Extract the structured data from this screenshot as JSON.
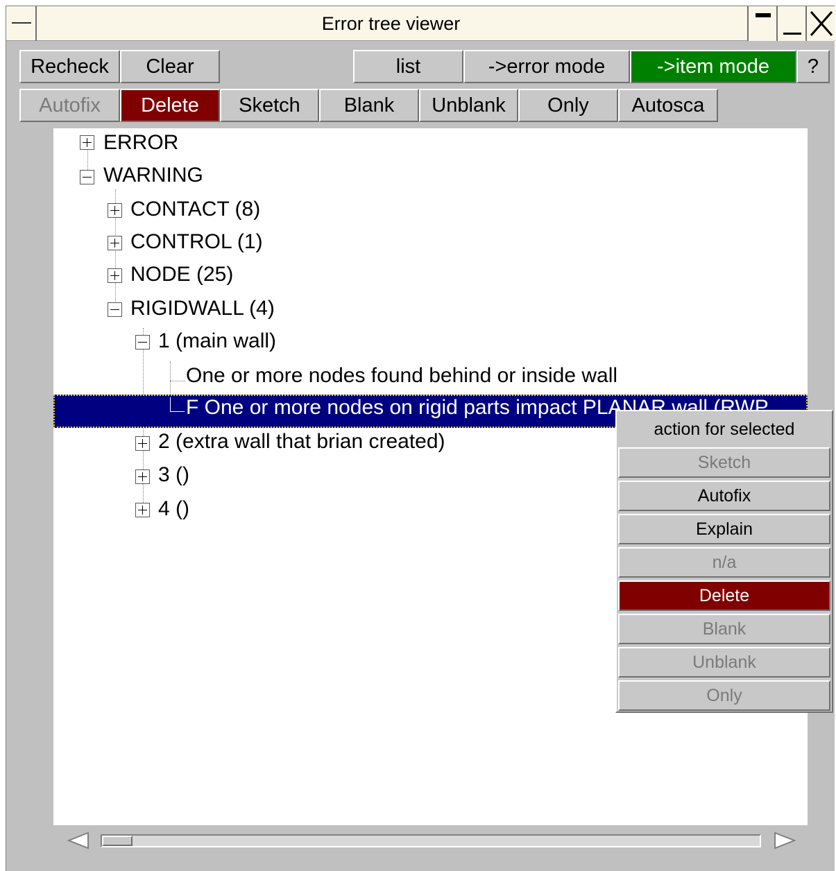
{
  "window": {
    "title": "Error tree viewer"
  },
  "toolbar_row1": {
    "recheck": "Recheck",
    "clear": "Clear",
    "list": "list",
    "error_mode": "->error mode",
    "item_mode": "->item mode",
    "help": "?"
  },
  "toolbar_row2": {
    "autofix": "Autofix",
    "delete": "Delete",
    "sketch": "Sketch",
    "blank": "Blank",
    "unblank": "Unblank",
    "only": "Only",
    "autoscale": "Autosca"
  },
  "tree": {
    "error": "ERROR",
    "warning": "WARNING",
    "contact": "CONTACT (8)",
    "control": "CONTROL (1)",
    "node": "NODE (25)",
    "rigidwall": "RIGIDWALL (4)",
    "wall1": "1 (main wall)",
    "wall1_msg1": "One or more nodes found behind or inside wall",
    "wall1_msg2": "F One or more nodes on rigid parts impact PLANAR wall (RWP",
    "wall2": "2 (extra wall that brian created)",
    "wall3": "3 ()",
    "wall4": "4 ()"
  },
  "context_menu": {
    "title": "action for selected",
    "items": [
      "Sketch",
      "Autofix",
      "Explain",
      "n/a",
      "Delete",
      "Blank",
      "Unblank",
      "Only"
    ]
  },
  "colors": {
    "accent_green": "#008000",
    "delete_red": "#800000",
    "selection": "#000080"
  }
}
